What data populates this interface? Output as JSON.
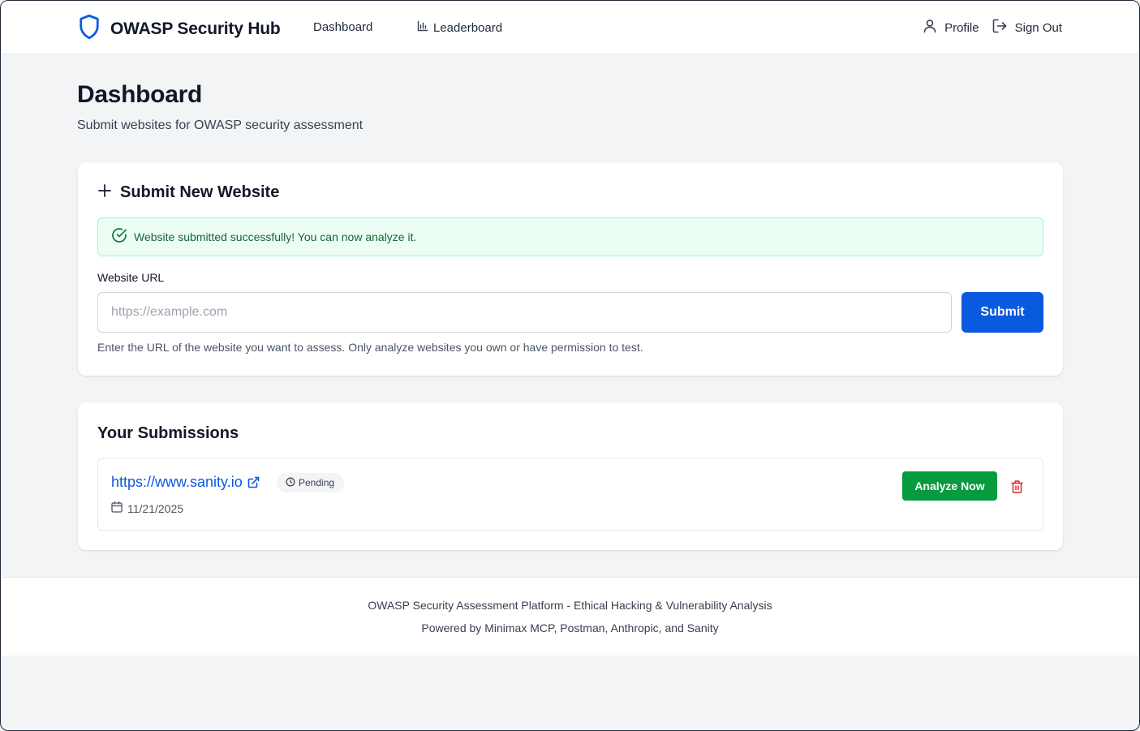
{
  "app": {
    "title": "OWASP Security Hub",
    "nav": {
      "dashboard": "Dashboard",
      "leaderboard": "Leaderboard"
    },
    "user_menu": {
      "profile": "Profile",
      "sign_out": "Sign Out"
    }
  },
  "page": {
    "title": "Dashboard",
    "subtitle": "Submit websites for OWASP security assessment"
  },
  "submit_card": {
    "heading": "Submit New Website",
    "alert": "Website submitted successfully! You can now analyze it.",
    "field_label": "Website URL",
    "placeholder": "https://example.com",
    "value": "",
    "submit_label": "Submit",
    "hint": "Enter the URL of the website you want to assess. Only analyze websites you own or have permission to test."
  },
  "submissions": {
    "heading": "Your Submissions",
    "items": [
      {
        "url": "https://www.sanity.io",
        "status": "Pending",
        "date": "11/21/2025",
        "action_label": "Analyze Now"
      }
    ]
  },
  "footer": {
    "line1": "OWASP Security Assessment Platform - Ethical Hacking & Vulnerability Analysis",
    "line2": "Powered by Minimax MCP, Postman, Anthropic, and Sanity"
  },
  "colors": {
    "brand_blue": "#0a5ae0",
    "success_green": "#079a3f",
    "alert_bg": "#ecfdf3",
    "danger_red": "#dc2626"
  },
  "icons": {
    "logo": "shield-icon",
    "leaderboard": "bar-chart-icon",
    "profile": "user-icon",
    "sign_out": "logout-icon",
    "add": "plus-icon",
    "success": "check-circle-icon",
    "external": "external-link-icon",
    "pending": "clock-icon",
    "date": "calendar-icon",
    "delete": "trash-icon"
  }
}
